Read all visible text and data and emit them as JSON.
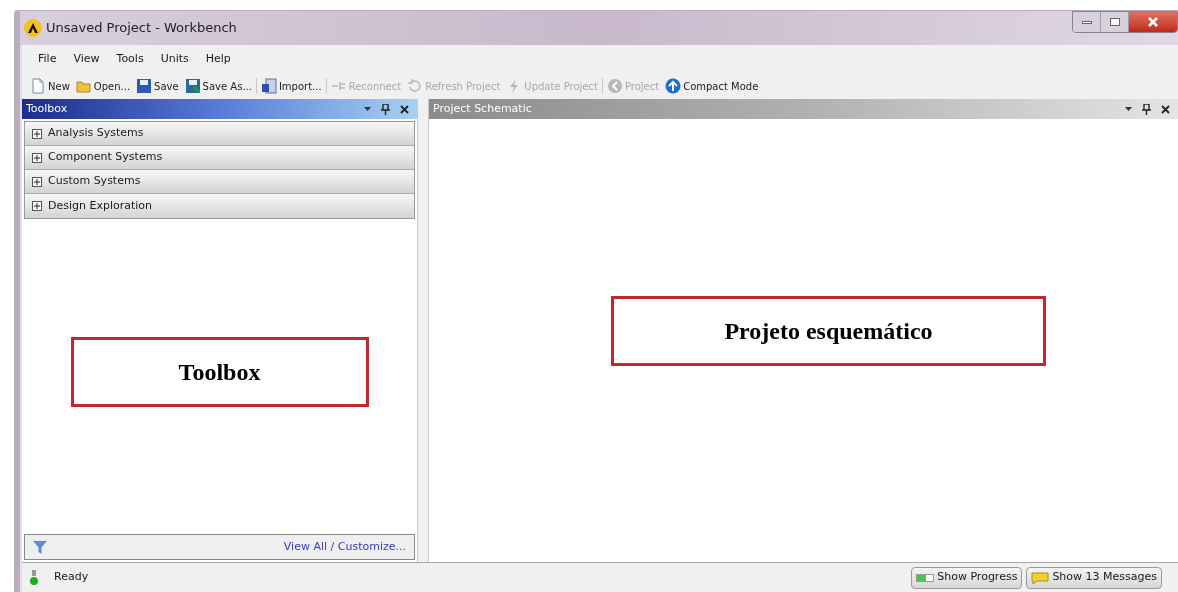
{
  "window": {
    "title": "Unsaved Project - Workbench"
  },
  "menu": [
    "File",
    "View",
    "Tools",
    "Units",
    "Help"
  ],
  "toolbar": [
    [
      {
        "label": "New",
        "kind": "new",
        "disabled": false
      },
      {
        "label": "Open...",
        "kind": "open",
        "disabled": false
      },
      {
        "label": "Save",
        "kind": "save",
        "disabled": false
      },
      {
        "label": "Save As...",
        "kind": "saveas",
        "disabled": false
      }
    ],
    [
      {
        "label": "Import...",
        "kind": "import",
        "disabled": false
      }
    ],
    [
      {
        "label": "Reconnect",
        "kind": "reconnect",
        "disabled": true
      },
      {
        "label": "Refresh Project",
        "kind": "refresh",
        "disabled": true
      },
      {
        "label": "Update Project",
        "kind": "update",
        "disabled": true
      }
    ],
    [
      {
        "label": "Project",
        "kind": "back",
        "disabled": true
      },
      {
        "label": "Compact Mode",
        "kind": "up",
        "disabled": false
      }
    ]
  ],
  "toolbox": {
    "title": "Toolbox",
    "groups": [
      {
        "label": "Analysis Systems",
        "expanded": false
      },
      {
        "label": "Component Systems",
        "expanded": false
      },
      {
        "label": "Custom Systems",
        "expanded": false
      },
      {
        "label": "Design Exploration",
        "expanded": false
      }
    ],
    "annotation": "Toolbox",
    "link": "View All / Customize..."
  },
  "schematic": {
    "title": "Project Schematic",
    "annotation": "Projeto esquemático"
  },
  "status_bar": {
    "text": "Ready",
    "buttons": [
      "Show Progress",
      "Show 13 Messages"
    ]
  }
}
